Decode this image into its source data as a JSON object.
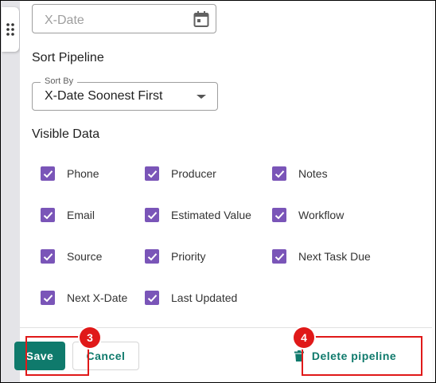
{
  "date_field": {
    "placeholder": "X-Date",
    "icon": "calendar-icon"
  },
  "sort": {
    "title": "Sort Pipeline",
    "legend": "Sort By",
    "value": "X-Date Soonest First"
  },
  "visible_data": {
    "title": "Visible Data",
    "items": [
      {
        "label": "Phone",
        "checked": true
      },
      {
        "label": "Producer",
        "checked": true
      },
      {
        "label": "Notes",
        "checked": true
      },
      {
        "label": "Email",
        "checked": true
      },
      {
        "label": "Estimated Value",
        "checked": true
      },
      {
        "label": "Workflow",
        "checked": true
      },
      {
        "label": "Source",
        "checked": true
      },
      {
        "label": "Priority",
        "checked": true
      },
      {
        "label": "Next Task Due",
        "checked": true
      },
      {
        "label": "Next X-Date",
        "checked": true
      },
      {
        "label": "Last Updated",
        "checked": true
      }
    ]
  },
  "footer": {
    "save_label": "Save",
    "cancel_label": "Cancel",
    "delete_label": "Delete pipeline"
  },
  "annotations": {
    "step_save": "3",
    "step_delete": "4"
  },
  "colors": {
    "checkbox": "#7a55b8",
    "primary": "#0f7a6c",
    "annotation": "#e01919"
  }
}
